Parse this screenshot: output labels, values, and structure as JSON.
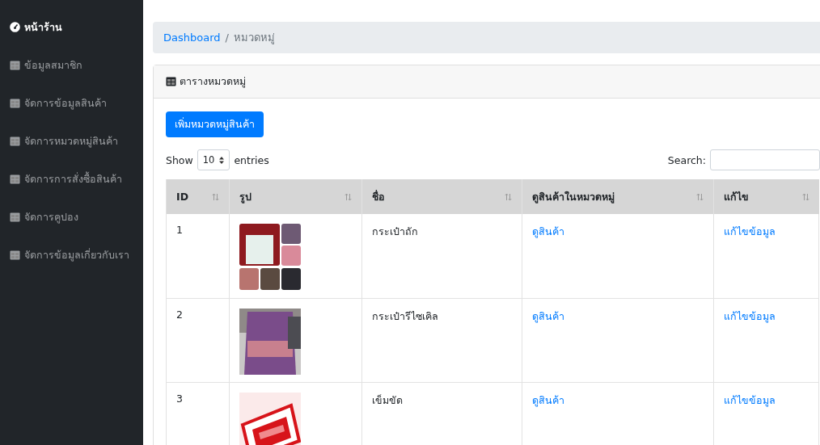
{
  "sidebar": {
    "items": [
      {
        "label": "หน้าร้าน",
        "kind": "dashboard",
        "selected": true
      },
      {
        "label": "ข้อมูลสมาชิก",
        "kind": "table",
        "selected": false
      },
      {
        "label": "จัดการข้อมูลสินค้า",
        "kind": "table",
        "selected": false
      },
      {
        "label": "จัดการหมวดหมู่สินค้า",
        "kind": "table",
        "selected": false
      },
      {
        "label": "จัดการการสั่งซื้อสินค้า",
        "kind": "table",
        "selected": false
      },
      {
        "label": "จัดการคูปอง",
        "kind": "table",
        "selected": false
      },
      {
        "label": "จัดการข้อมูลเกี่ยวกับเรา",
        "kind": "table",
        "selected": false
      }
    ]
  },
  "breadcrumb": {
    "items": [
      {
        "label": "Dashboard",
        "kind": "link"
      },
      {
        "label": "หมวดหมู่",
        "kind": "current"
      }
    ],
    "separator": "/"
  },
  "card": {
    "title": "ตารางหมวดหมู่",
    "add_button": "เพิ่มหมวดหมู่สินค้า",
    "length": {
      "show": "Show",
      "value": "10",
      "entries": "entries"
    },
    "search": {
      "label": "Search:"
    },
    "table": {
      "columns": [
        "ID",
        "รูป",
        "ชื่อ",
        "ดูสินค้าในหมวดหมู่",
        "แก้ไข"
      ],
      "rows": [
        {
          "id": "1",
          "name": "กระเป๋าถัก",
          "view": "ดูสินค้า",
          "edit": "แก้ไขข้อมูล"
        },
        {
          "id": "2",
          "name": "กระเป๋ารีไซเคิล",
          "view": "ดูสินค้า",
          "edit": "แก้ไขข้อมูล"
        },
        {
          "id": "3",
          "name": "เข็มขัด",
          "view": "ดูสินค้า",
          "edit": "แก้ไขข้อมูล"
        }
      ]
    }
  }
}
